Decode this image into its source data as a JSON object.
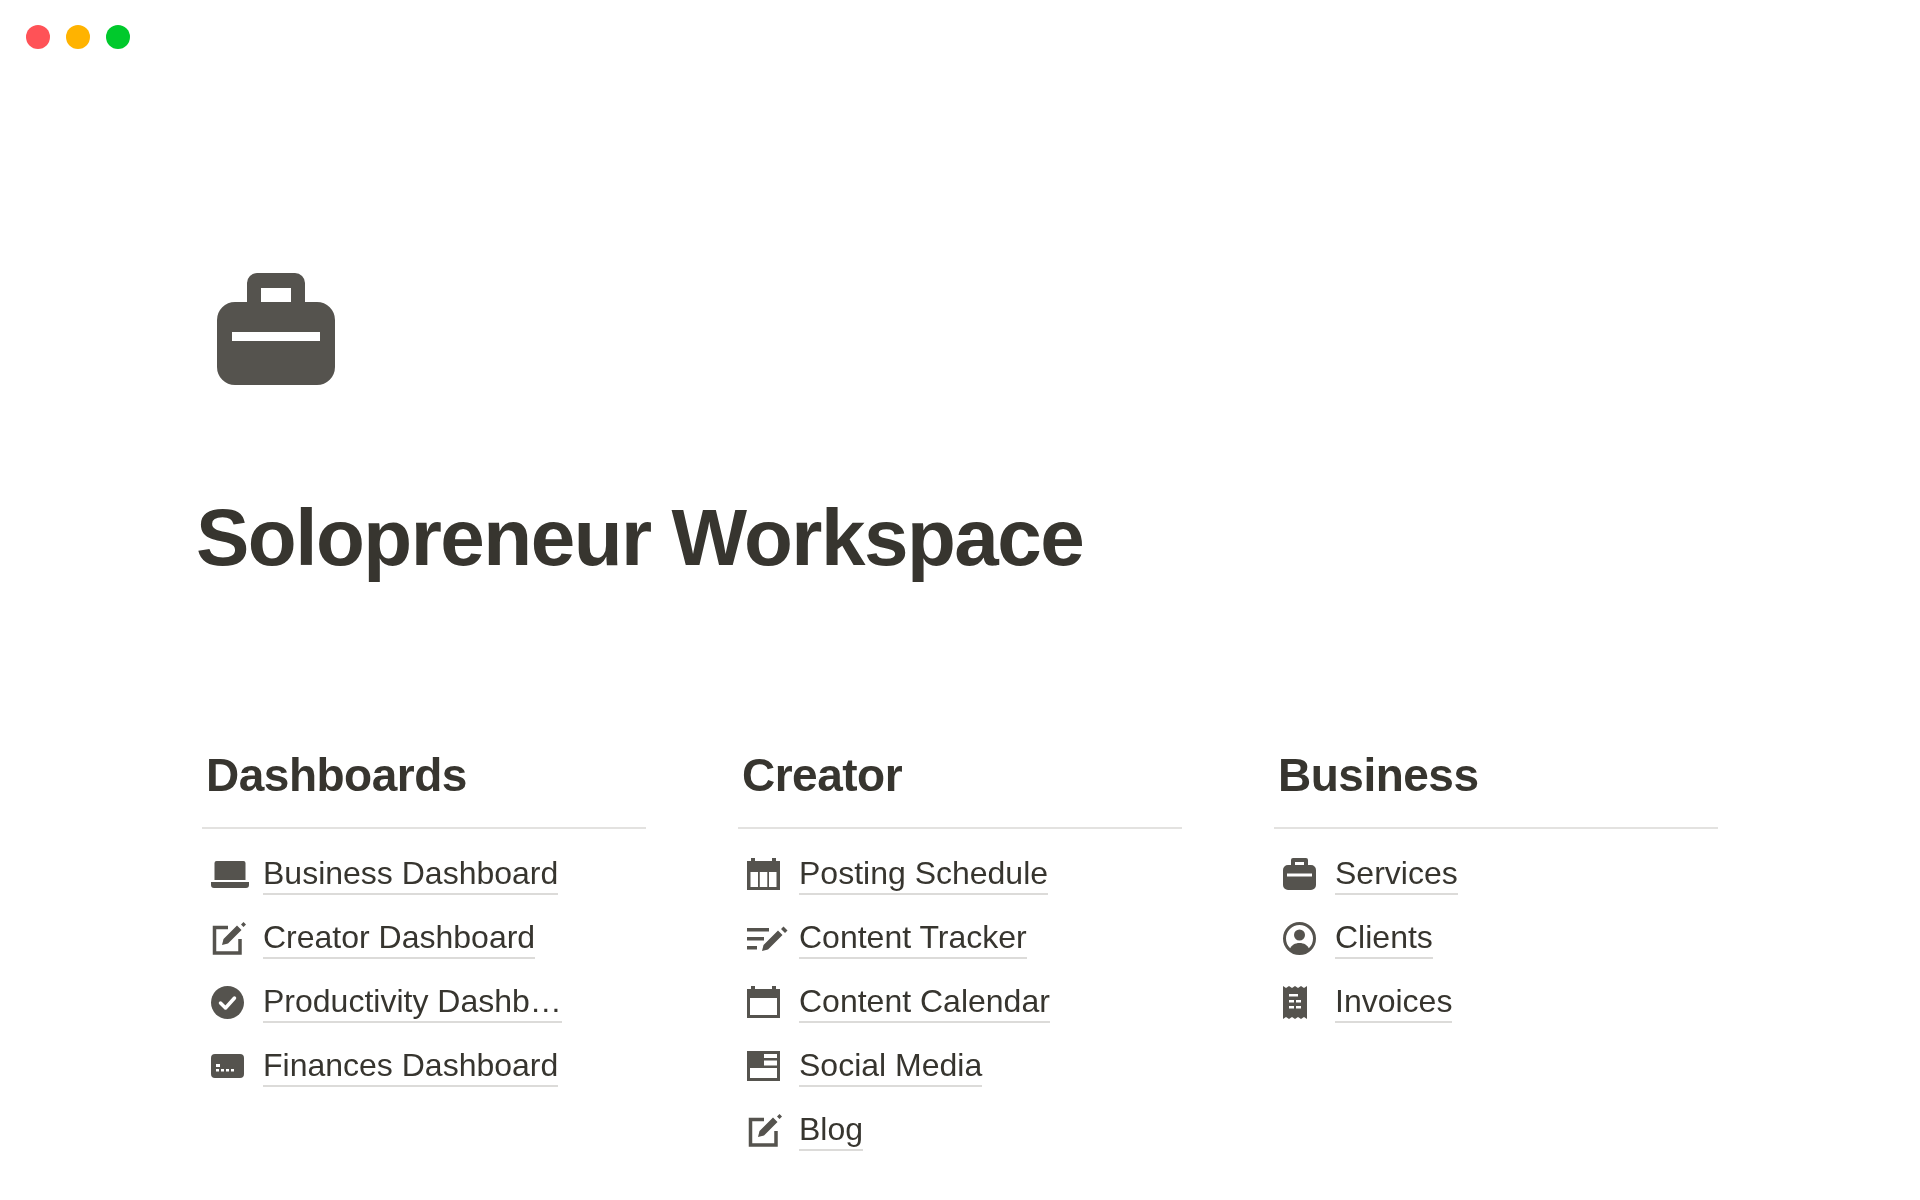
{
  "page": {
    "title": "Solopreneur Workspace"
  },
  "sections": [
    {
      "heading": "Dashboards",
      "links": [
        "Business Dashboard",
        "Creator Dashboard",
        "Productivity Dashb…",
        "Finances Dashboard"
      ]
    },
    {
      "heading": "Creator",
      "links": [
        "Posting Schedule",
        "Content Tracker",
        "Content Calendar",
        "Social Media",
        "Blog"
      ]
    },
    {
      "heading": "Business",
      "links": [
        "Services",
        "Clients",
        "Invoices"
      ]
    }
  ]
}
